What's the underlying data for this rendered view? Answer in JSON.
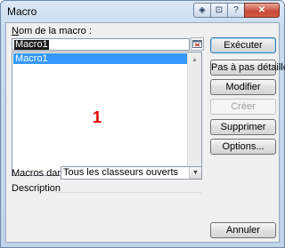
{
  "window": {
    "title": "Macro",
    "controls": [
      "◈",
      "⊡",
      "?",
      "✕"
    ]
  },
  "dialog": {
    "name_label": "Nom de la macro :",
    "name_value": "Macro1",
    "list_items": [
      "Macro1"
    ],
    "annotation": "1",
    "macros_in_label": "Macros dans :",
    "macros_in_value": "Tous les classeurs ouverts",
    "description_label": "Description"
  },
  "buttons": {
    "run": "Exécuter",
    "step_into": "Pas à pas détaillé",
    "edit": "Modifier",
    "create": "Créer",
    "delete": "Supprimer",
    "options": "Options...",
    "cancel": "Annuler"
  },
  "colors": {
    "selection": "#3399ff",
    "annotation": "#e60000"
  }
}
